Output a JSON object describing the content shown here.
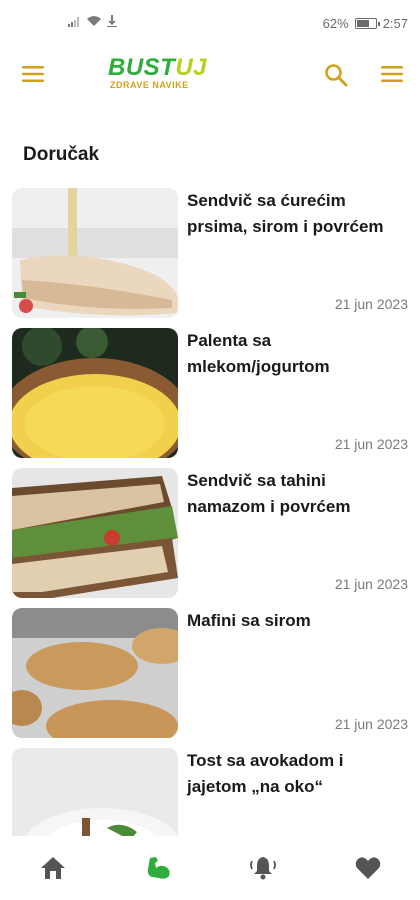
{
  "status": {
    "battery": "62%",
    "time": "2:57"
  },
  "header": {
    "logo_main_1": "BUST",
    "logo_main_2": "UJ",
    "logo_sub": "ZDRAVE NAVIKE"
  },
  "page": {
    "title": "Doručak"
  },
  "recipes": [
    {
      "title": "Sendvič sa ćurećim prsima, sirom i povrćem",
      "date": "21 jun 2023"
    },
    {
      "title": "Palenta sa mlekom/jogurtom",
      "date": "21 jun 2023"
    },
    {
      "title": "Sendvič sa tahini namazom i povrćem",
      "date": "21 jun 2023"
    },
    {
      "title": "Mafini sa sirom",
      "date": "21 jun 2023"
    },
    {
      "title": "Tost sa avokadom i jajetom „na oko“",
      "date": ""
    }
  ],
  "colors": {
    "accent": "#d1a21a",
    "brand": "#2eac3c",
    "nav_active": "#2eac3c",
    "nav_inactive": "#555555"
  },
  "icons": {
    "menu": "hamburger-icon",
    "search": "search-icon",
    "home": "home-icon",
    "strength": "flexed-arm-icon",
    "notifications": "bell-icon",
    "favorites": "heart-icon"
  }
}
